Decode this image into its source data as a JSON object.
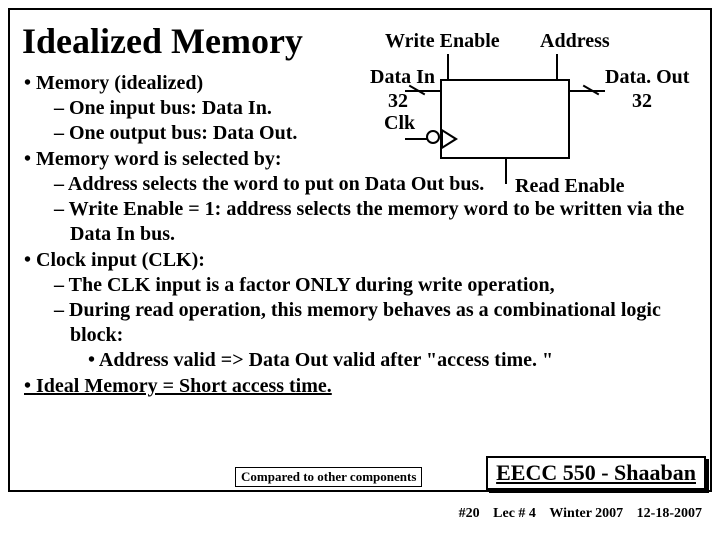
{
  "title": "Idealized Memory",
  "diagram": {
    "write_enable": "Write Enable",
    "address": "Address",
    "data_in": "Data In",
    "data_in_width": "32",
    "data_out": "Data. Out",
    "data_out_width": "32",
    "clk": "Clk",
    "read_enable": "Read Enable"
  },
  "bullets": {
    "b1": "Memory (idealized)",
    "b1a": "One input bus:  Data In.",
    "b1b": "One output bus:  Data Out.",
    "b2": "Memory word is selected by:",
    "b2a": "Address selects the word to put on Data Out bus.",
    "b2b": "Write Enable = 1:  address selects the memory word to be written via the  Data In bus.",
    "b3": "Clock input (CLK):",
    "b3a": "The CLK input is a factor ONLY during write operation,",
    "b3b": "During read operation, this memory behaves  as a combinational logic block:",
    "b3b1": "Address valid  =>  Data Out valid after \"access time. \"",
    "b4": "Ideal Memory = Short access time."
  },
  "compared": "Compared to other components",
  "footer_box": "EECC 550 - Shaaban",
  "footer": {
    "slide": "#20",
    "lec": "Lec # 4",
    "term": "Winter 2007",
    "date": "12-18-2007"
  }
}
